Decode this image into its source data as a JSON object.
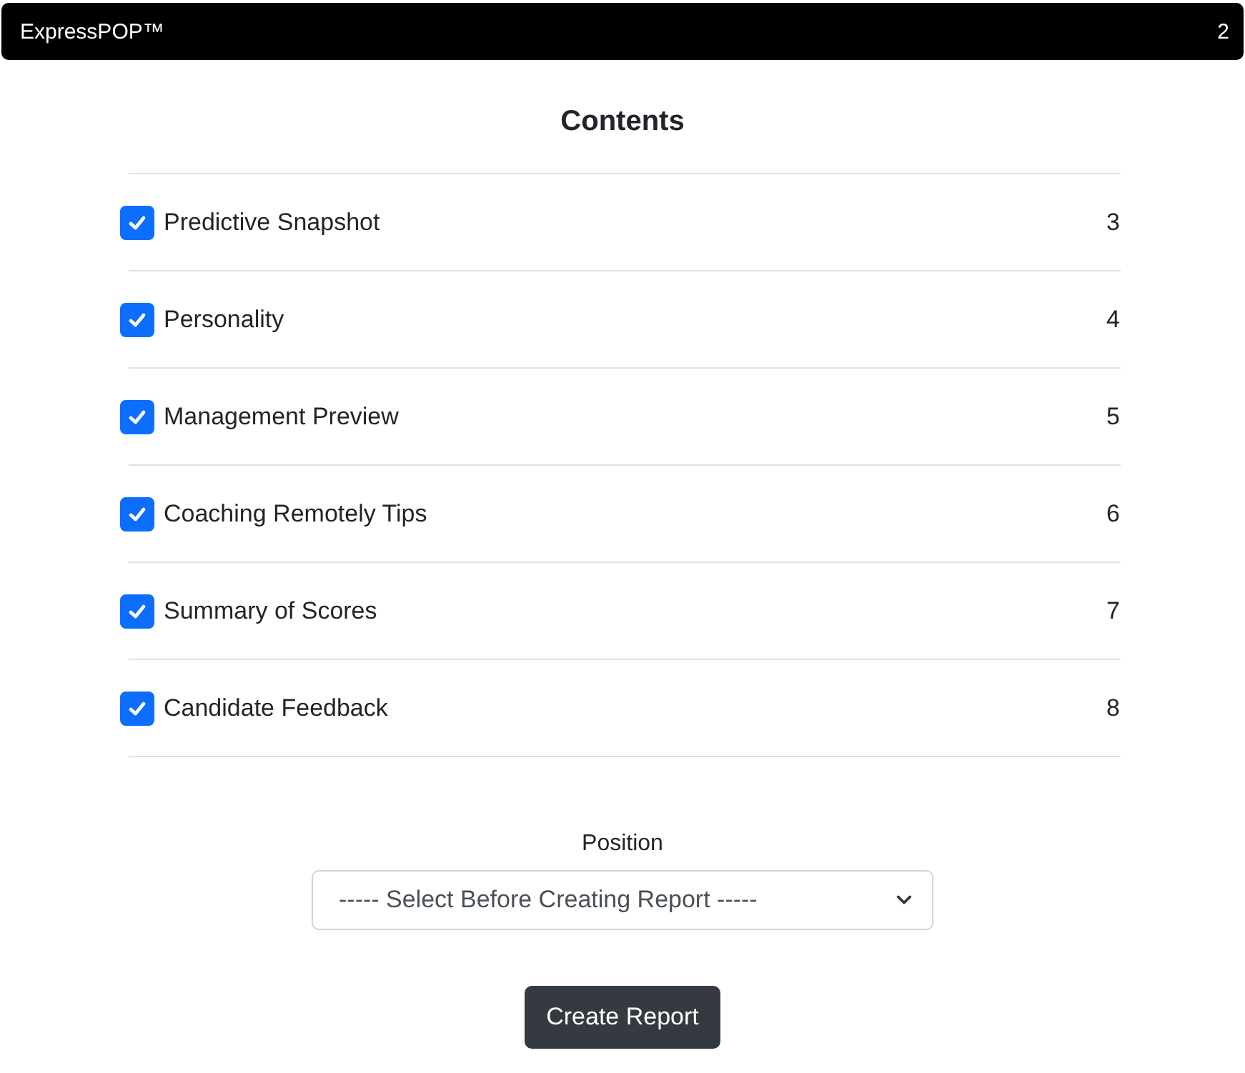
{
  "header": {
    "title": "ExpressPOP™",
    "page_number": "2"
  },
  "contents": {
    "title": "Contents",
    "items": [
      {
        "label": "Predictive Snapshot",
        "page": "3",
        "checked": true
      },
      {
        "label": "Personality",
        "page": "4",
        "checked": true
      },
      {
        "label": "Management Preview",
        "page": "5",
        "checked": true
      },
      {
        "label": "Coaching Remotely Tips",
        "page": "6",
        "checked": true
      },
      {
        "label": "Summary of Scores",
        "page": "7",
        "checked": true
      },
      {
        "label": "Candidate Feedback",
        "page": "8",
        "checked": true
      }
    ]
  },
  "position": {
    "label": "Position",
    "value": "----- Select Before Creating Report -----"
  },
  "buttons": [
    "Create Report"
  ]
}
